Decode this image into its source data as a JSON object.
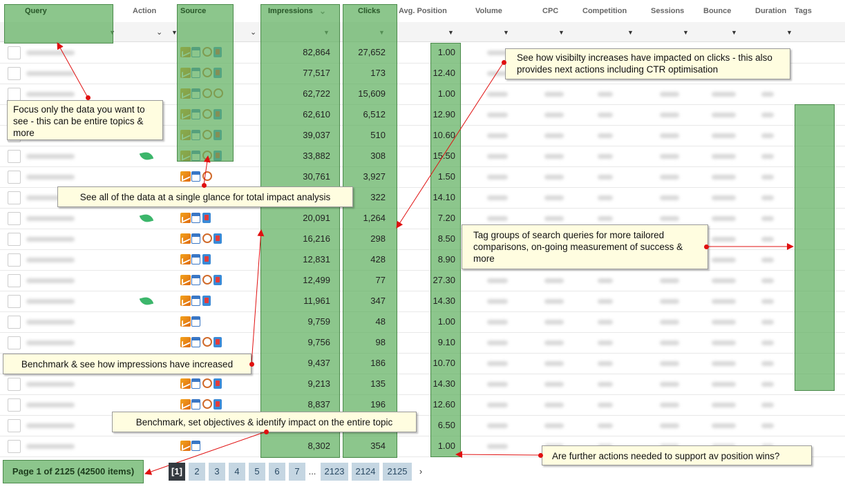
{
  "columns": {
    "query": "Query",
    "action": "Action",
    "source": "Source",
    "impressions": "Impressions",
    "clicks": "Clicks",
    "avg_position": "Avg. Position",
    "volume": "Volume",
    "cpc": "CPC",
    "competition": "Competition",
    "sessions": "Sessions",
    "bounce": "Bounce",
    "duration": "Duration",
    "tags": "Tags"
  },
  "rows": [
    {
      "impressions": "82,864",
      "clicks": "27,652",
      "avg_position": "1.00",
      "leaf": false,
      "icons": [
        "graph-icon",
        "calendar-icon",
        "ring-icon",
        "flag-icon"
      ]
    },
    {
      "impressions": "77,517",
      "clicks": "173",
      "avg_position": "12.40",
      "leaf": false,
      "icons": [
        "graph-icon",
        "calendar-icon",
        "ring-icon",
        "flag-icon"
      ]
    },
    {
      "impressions": "62,722",
      "clicks": "15,609",
      "avg_position": "1.00",
      "leaf": false,
      "icons": [
        "graph-icon",
        "calendar-icon",
        "ring-icon",
        "ring-icon"
      ]
    },
    {
      "impressions": "62,610",
      "clicks": "6,512",
      "avg_position": "12.90",
      "leaf": false,
      "icons": [
        "graph-icon",
        "calendar-icon",
        "ring-icon",
        "flag-icon"
      ]
    },
    {
      "impressions": "39,037",
      "clicks": "510",
      "avg_position": "10.60",
      "leaf": false,
      "icons": [
        "graph-icon",
        "calendar-icon",
        "ring-icon",
        "flag-icon"
      ]
    },
    {
      "impressions": "33,882",
      "clicks": "308",
      "avg_position": "15.50",
      "leaf": true,
      "icons": [
        "graph-icon",
        "calendar-icon",
        "ring-icon",
        "flag-icon"
      ]
    },
    {
      "impressions": "30,761",
      "clicks": "3,927",
      "avg_position": "1.50",
      "leaf": false,
      "icons": [
        "graph-icon",
        "calendar-icon",
        "ring-icon"
      ]
    },
    {
      "impressions": "",
      "clicks": "322",
      "avg_position": "14.10",
      "leaf": false,
      "icons": []
    },
    {
      "impressions": "20,091",
      "clicks": "1,264",
      "avg_position": "7.20",
      "leaf": true,
      "icons": [
        "graph-icon",
        "calendar-icon",
        "flag-icon"
      ]
    },
    {
      "impressions": "16,216",
      "clicks": "298",
      "avg_position": "8.50",
      "leaf": false,
      "icons": [
        "graph-icon",
        "calendar-icon",
        "ring-icon",
        "flag-icon"
      ]
    },
    {
      "impressions": "12,831",
      "clicks": "428",
      "avg_position": "8.90",
      "leaf": false,
      "icons": [
        "graph-icon",
        "calendar-icon",
        "flag-icon"
      ]
    },
    {
      "impressions": "12,499",
      "clicks": "77",
      "avg_position": "27.30",
      "leaf": false,
      "icons": [
        "graph-icon",
        "calendar-icon",
        "ring-icon",
        "flag-icon"
      ]
    },
    {
      "impressions": "11,961",
      "clicks": "347",
      "avg_position": "14.30",
      "leaf": true,
      "icons": [
        "graph-icon",
        "calendar-icon",
        "flag-icon"
      ]
    },
    {
      "impressions": "9,759",
      "clicks": "48",
      "avg_position": "1.00",
      "leaf": false,
      "icons": [
        "graph-icon",
        "calendar-icon"
      ]
    },
    {
      "impressions": "9,756",
      "clicks": "98",
      "avg_position": "9.10",
      "leaf": false,
      "icons": [
        "graph-icon",
        "calendar-icon",
        "ring-icon",
        "flag-icon"
      ]
    },
    {
      "impressions": "9,437",
      "clicks": "186",
      "avg_position": "10.70",
      "leaf": false,
      "icons": []
    },
    {
      "impressions": "9,213",
      "clicks": "135",
      "avg_position": "14.30",
      "leaf": false,
      "icons": [
        "graph-icon",
        "calendar-icon",
        "ring-icon",
        "flag-icon"
      ]
    },
    {
      "impressions": "8,837",
      "clicks": "196",
      "avg_position": "12.60",
      "leaf": false,
      "icons": [
        "graph-icon",
        "calendar-icon",
        "ring-icon",
        "flag-icon"
      ]
    },
    {
      "impressions": "",
      "clicks": "",
      "avg_position": "6.50",
      "leaf": false,
      "icons": [
        "graph-icon",
        "calendar-icon"
      ]
    },
    {
      "impressions": "8,302",
      "clicks": "354",
      "avg_position": "1.00",
      "leaf": false,
      "icons": [
        "graph-icon",
        "calendar-icon"
      ]
    }
  ],
  "callouts": {
    "focus": "Focus only the data you want to see - this can be entire topics & more",
    "glance": "See all of the data at a single glance for total impact analysis",
    "visibility": "See how visibilty increases have impacted on clicks - this also provides next actions including CTR optimisation",
    "tags": "Tag groups of search queries for more tailored comparisons, on-going measurement of success & more",
    "impressions": "Benchmark & see how impressions have increased",
    "topic": "Benchmark, set objectives & identify impact on the entire topic",
    "position": "Are further actions needed to support av position wins?"
  },
  "pager": {
    "info": "Page 1 of 2125 (42500 items)",
    "pages": [
      "[1]",
      "2",
      "3",
      "4",
      "5",
      "6",
      "7"
    ],
    "ellipsis": "...",
    "last_pages": [
      "2123",
      "2124",
      "2125"
    ],
    "next": "›"
  },
  "colors": {
    "highlight_green": "#60b060",
    "callout_bg": "#fffde0",
    "arrow_red": "#e01010",
    "pager_bg": "#c5d6e2",
    "pager_active_bg": "#343a40"
  }
}
